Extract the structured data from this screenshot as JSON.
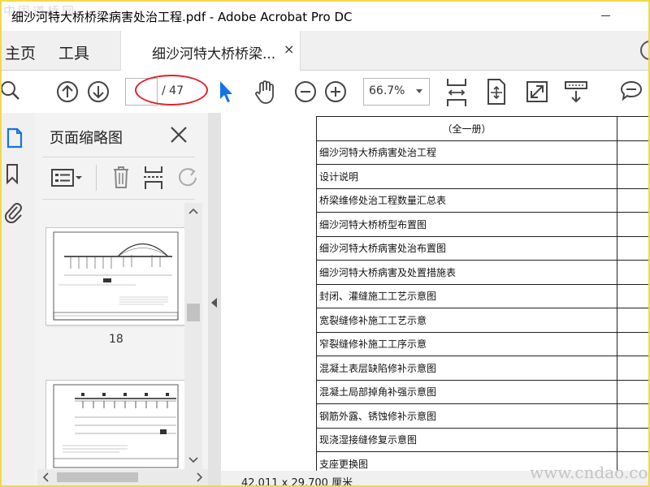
{
  "window": {
    "title": "细沙河特大桥桥梁病害处治工程.pdf - Adobe Acrobat Pro DC"
  },
  "watermarks": {
    "top_left": "中国道桥网",
    "bottom_right": "www.cndao.com"
  },
  "tabs": {
    "home_label": "主页",
    "tools_label": "工具",
    "document_label": "细沙河特大桥桥梁...",
    "close_symbol": "×"
  },
  "toolbar": {
    "current_page": "",
    "page_total": "/ 47",
    "zoom_value": "66.7%"
  },
  "panel": {
    "title": "页面缩略图",
    "thumbnails": [
      {
        "label": "18"
      }
    ]
  },
  "document": {
    "rows": [
      "（全一册）",
      "细沙河特大桥病害处治工程",
      "设计说明",
      "桥梁维修处治工程数量汇总表",
      "细沙河特大桥桥型布置图",
      "细沙河特大桥病害处治布置图",
      "细沙河特大桥病害及处置措施表",
      "封闭、灌缝施工工艺示意图",
      "宽裂缝修补施工工艺示意",
      "窄裂缝修补施工工序示意",
      "混凝土表层缺陷修补示意图",
      "混凝土局部掉角补强示意图",
      "钢筋外露、锈蚀修补示意图",
      "现浇湿接缝修复示意图",
      "支座更换图"
    ]
  },
  "status": {
    "page_size": "42.011 x 29.700 厘米"
  },
  "colors": {
    "annotation_ellipse": "#e4202c",
    "select_tool_blue": "#1473e6",
    "frame_border": "#f2d84a",
    "panel_bg": "#f3f3f3"
  },
  "icons": [
    "search-icon",
    "page-up-icon",
    "page-down-icon",
    "select-arrow-icon",
    "hand-tool-icon",
    "zoom-out-icon",
    "zoom-in-icon",
    "fit-width-icon",
    "fit-page-icon",
    "fullscreen-icon",
    "scroll-mode-icon",
    "comment-icon",
    "thumbnail-panel-icon",
    "bookmark-icon",
    "attachment-icon",
    "thumbnail-options-icon",
    "delete-icon",
    "insert-page-icon",
    "rotate-icon",
    "close-icon",
    "minimize-icon"
  ]
}
